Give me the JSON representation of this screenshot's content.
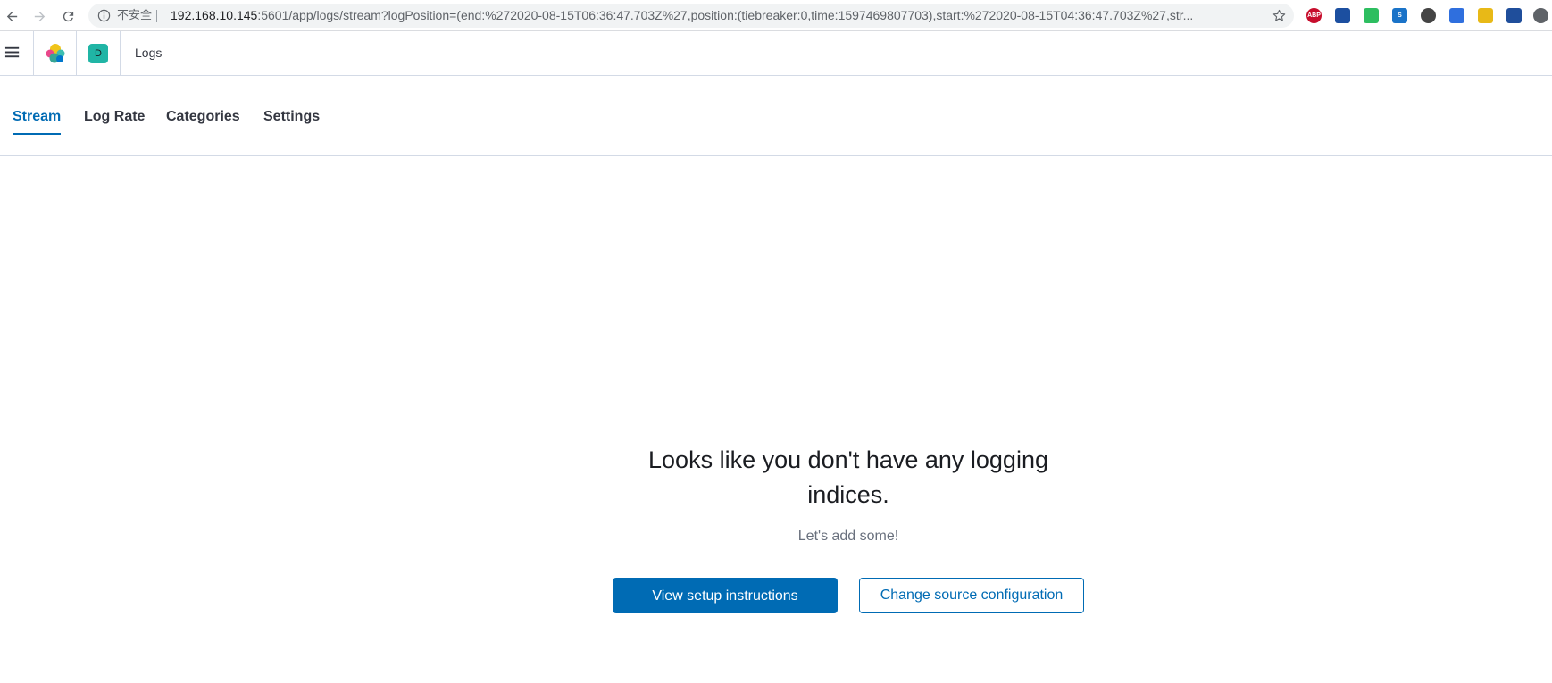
{
  "browser": {
    "security_label": "不安全",
    "url_host": "192.168.10.145",
    "url_path": ":5601/app/logs/stream?logPosition=(end:%272020-08-15T06:36:47.703Z%27,position:(tiebreaker:0,time:1597469807703),start:%272020-08-15T04:36:47.703Z%27,str...",
    "extensions": [
      {
        "name": "adblock-plus-icon",
        "label": "ABP",
        "color": "#c70d2c"
      },
      {
        "name": "save-icon",
        "label": "",
        "color": "#1c4fa0"
      },
      {
        "name": "evernote-icon",
        "label": "",
        "color": "#2dbe60"
      },
      {
        "name": "s-extension-icon",
        "label": "S",
        "color": "#1a73c8"
      },
      {
        "name": "incognito-glasses-icon",
        "label": "",
        "color": "#444444"
      },
      {
        "name": "sync-icon",
        "label": "",
        "color": "#2f6fde"
      },
      {
        "name": "tampermonkey-icon",
        "label": "",
        "color": "#e8b917"
      },
      {
        "name": "download-icon",
        "label": "",
        "color": "#1f4e9b"
      },
      {
        "name": "settings-extension-icon",
        "label": "",
        "color": "#5f6368"
      }
    ]
  },
  "header": {
    "space_initial": "D",
    "breadcrumb": "Logs"
  },
  "tabs": [
    {
      "label": "Stream",
      "active": true
    },
    {
      "label": "Log Rate",
      "active": false
    },
    {
      "label": "Categories",
      "active": false
    },
    {
      "label": "Settings",
      "active": false
    }
  ],
  "empty_state": {
    "title_line1": "Looks like you don't have any logging",
    "title_line2": "indices.",
    "body": "Let's add some!",
    "primary_button": "View setup instructions",
    "secondary_button": "Change source configuration"
  },
  "colors": {
    "accent": "#006bb4",
    "space_avatar": "#20b5a5"
  }
}
